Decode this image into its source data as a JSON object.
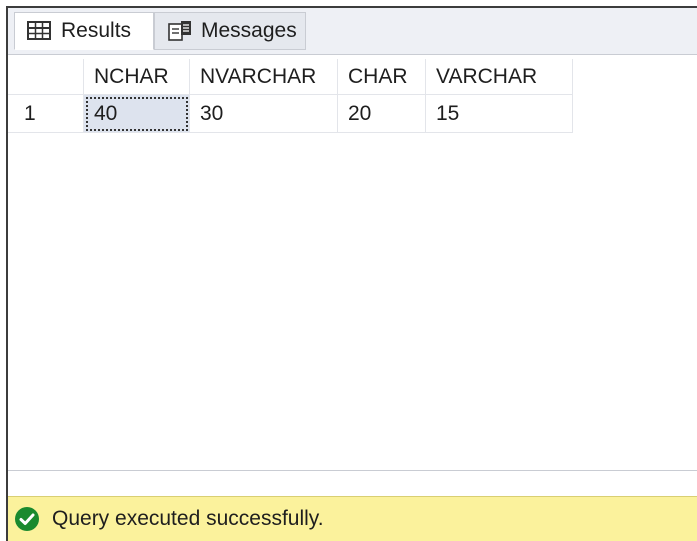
{
  "tabs": [
    {
      "label": "Results",
      "icon": "grid-icon",
      "active": true
    },
    {
      "label": "Messages",
      "icon": "messages-icon",
      "active": false
    }
  ],
  "grid": {
    "columns": [
      "",
      "NCHAR",
      "NVARCHAR",
      "CHAR",
      "VARCHAR"
    ],
    "rows": [
      [
        "1",
        "40",
        "30",
        "20",
        "15"
      ]
    ]
  },
  "status": {
    "icon": "check-circle-icon",
    "text": "Query executed successfully.",
    "colors": {
      "background": "#fbf29c",
      "icon": "#1a8a2e"
    }
  }
}
